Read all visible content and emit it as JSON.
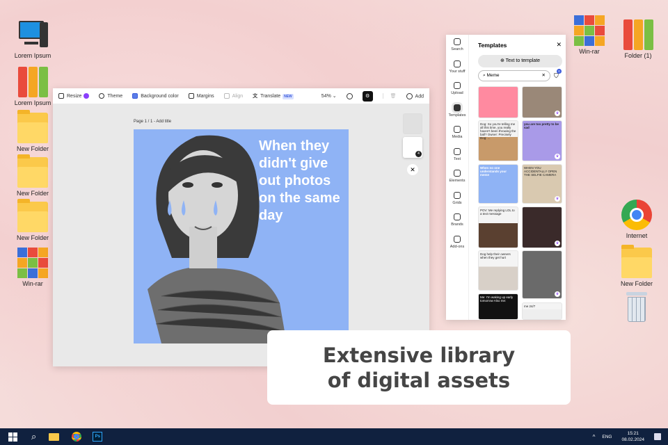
{
  "desktop": {
    "left": [
      "Lorem Ipsum",
      "Lorem Ipsum",
      "New Folder",
      "New Folder",
      "New Folder",
      "Win-rar"
    ],
    "right": [
      "Win-rar",
      "Folder (1)",
      "Internet",
      "New Folder"
    ]
  },
  "editor": {
    "toolbar": {
      "resize": "Resize",
      "theme": "Theme",
      "background_color": "Background color",
      "margins": "Margins",
      "align": "Align",
      "translate": "Translate",
      "new_badge": "NEW",
      "zoom": "54%",
      "add": "Add"
    },
    "page_label": "Page 1 / 1 - Add title",
    "meme_text": "When they didn't give out photos on the same day",
    "page_count": "4"
  },
  "panel": {
    "rail": [
      "Search",
      "Your stuff",
      "Upload",
      "Templates",
      "Media",
      "Text",
      "Elements",
      "Grids",
      "Brands",
      "Add-ons"
    ],
    "title": "Templates",
    "text_to_template": "Text to template",
    "search_value": "Meme",
    "filter_count": "0",
    "cards": [
      "",
      "",
      "Dog: So you're telling me all this time, you really haven't been throwing the ball? Owner: Precisely Dog: ...",
      "you are too pretty to be sad",
      "When no one understands your meme",
      "WHEN YOU ACCIDENTALLY OPEN THE SELFIE CAMERA",
      "POV: Me replying LOL to a text message",
      "",
      "Dog help their owners when they get hurt",
      "",
      "Me: I'm waking up early tomorrow Also me:",
      "me 24/7"
    ]
  },
  "caption": {
    "line1": "Extensive library",
    "line2": "of digital assets"
  },
  "taskbar": {
    "lang": "ENG",
    "time": "15:21",
    "date": "08.02.2024"
  }
}
